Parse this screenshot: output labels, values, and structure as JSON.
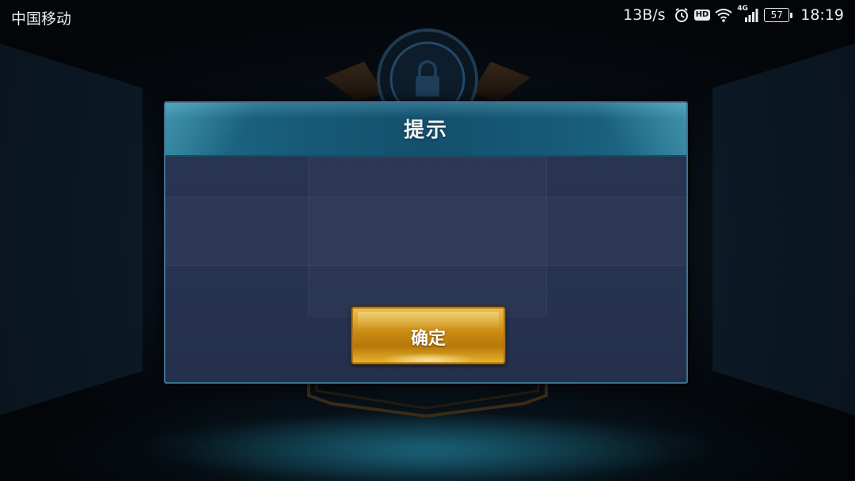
{
  "status_bar": {
    "carrier": "中国移动",
    "net_speed": "13B/s",
    "signal_type": "4G",
    "battery": "57",
    "time": "18:19",
    "icons": [
      "alarm-icon",
      "hd-icon",
      "wifi-icon",
      "signal-icon",
      "battery-icon"
    ]
  },
  "dialog": {
    "title": "提示",
    "confirm_label": "确定"
  },
  "colors": {
    "dialog_header": "#175a78",
    "dialog_body": "#273451",
    "button_gold": "#c98a12",
    "background": "#060b11"
  }
}
